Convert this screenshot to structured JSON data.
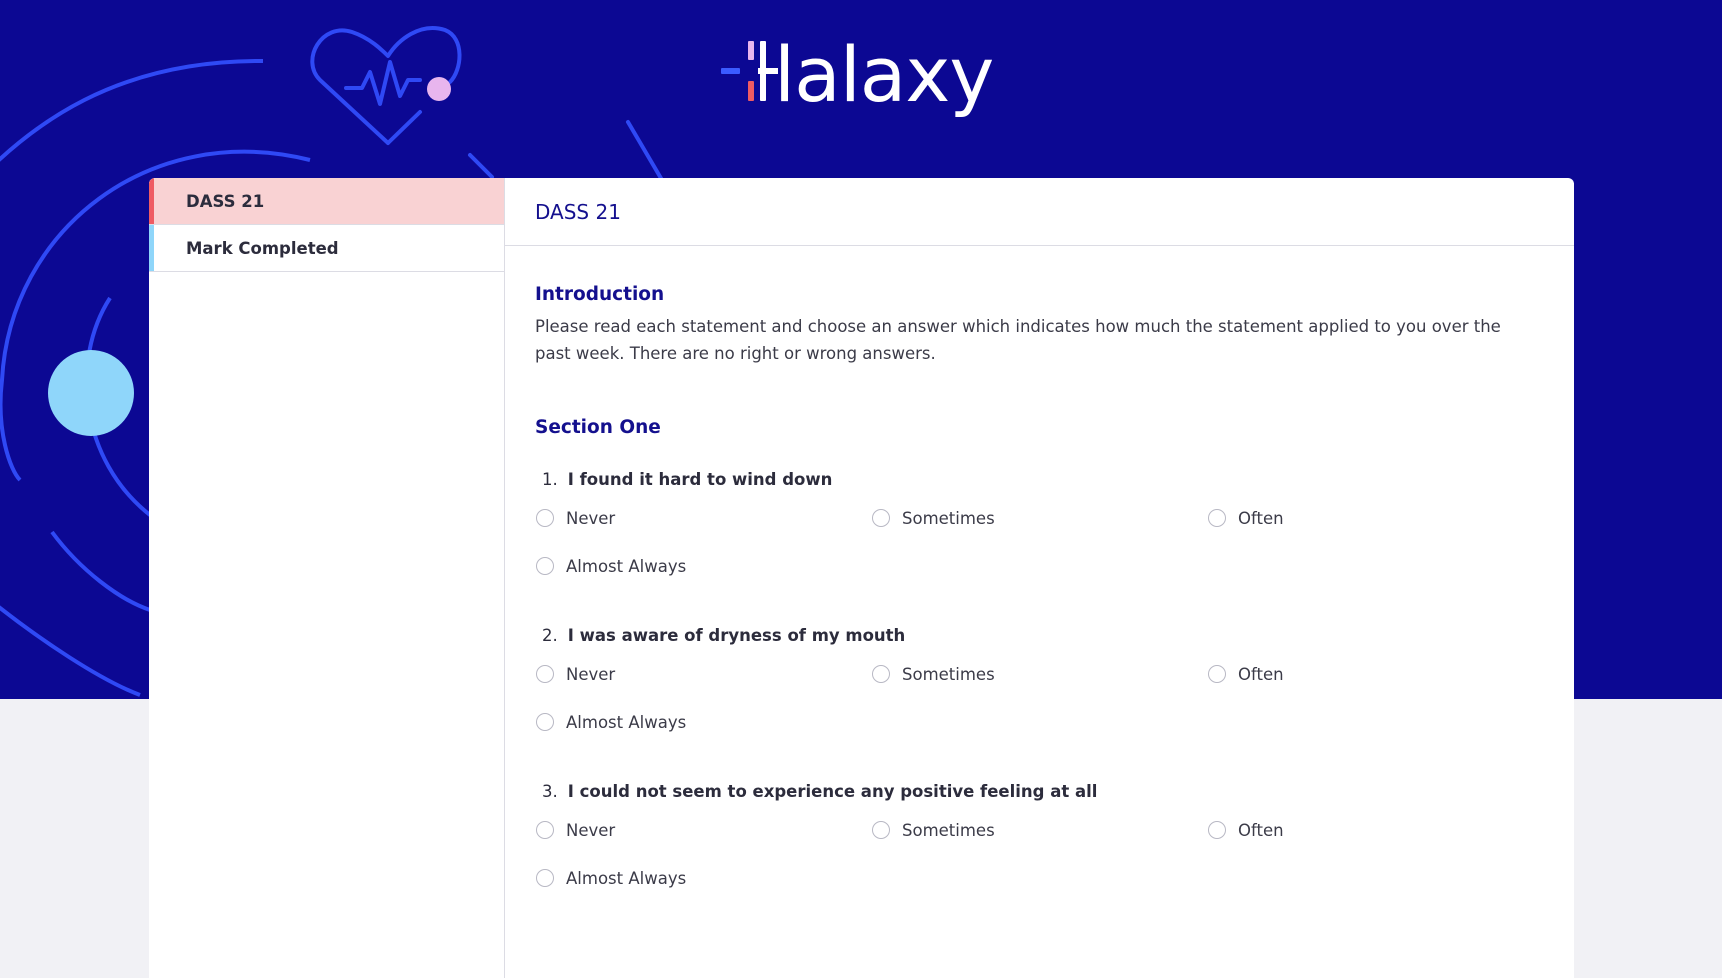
{
  "brand": {
    "name": "Halaxy",
    "logo_text": "lalaxy",
    "colors": {
      "hero_bg": "#0c0893",
      "accent_pink": "#ef5b63",
      "accent_blue": "#3b5bff",
      "accent_light_blue": "#8fd6fa",
      "title_navy": "#14108e"
    }
  },
  "sidebar": {
    "items": [
      {
        "label": "DASS 21",
        "active": true
      },
      {
        "label": "Mark Completed",
        "active": false
      }
    ]
  },
  "main": {
    "title": "DASS 21",
    "intro": {
      "title": "Introduction",
      "text": "Please read each statement and choose an answer which indicates how much the statement applied to you over the past week. There are no right or wrong answers."
    },
    "section_title": "Section One",
    "questions": [
      {
        "number": "1.",
        "text": "I found it hard to wind down",
        "options": [
          "Never",
          "Sometimes",
          "Often",
          "Almost Always"
        ]
      },
      {
        "number": "2.",
        "text": "I was aware of dryness of my mouth",
        "options": [
          "Never",
          "Sometimes",
          "Often",
          "Almost Always"
        ]
      },
      {
        "number": "3.",
        "text": "I could not seem to experience any positive feeling at all",
        "options": [
          "Never",
          "Sometimes",
          "Often",
          "Almost Always"
        ]
      }
    ]
  }
}
